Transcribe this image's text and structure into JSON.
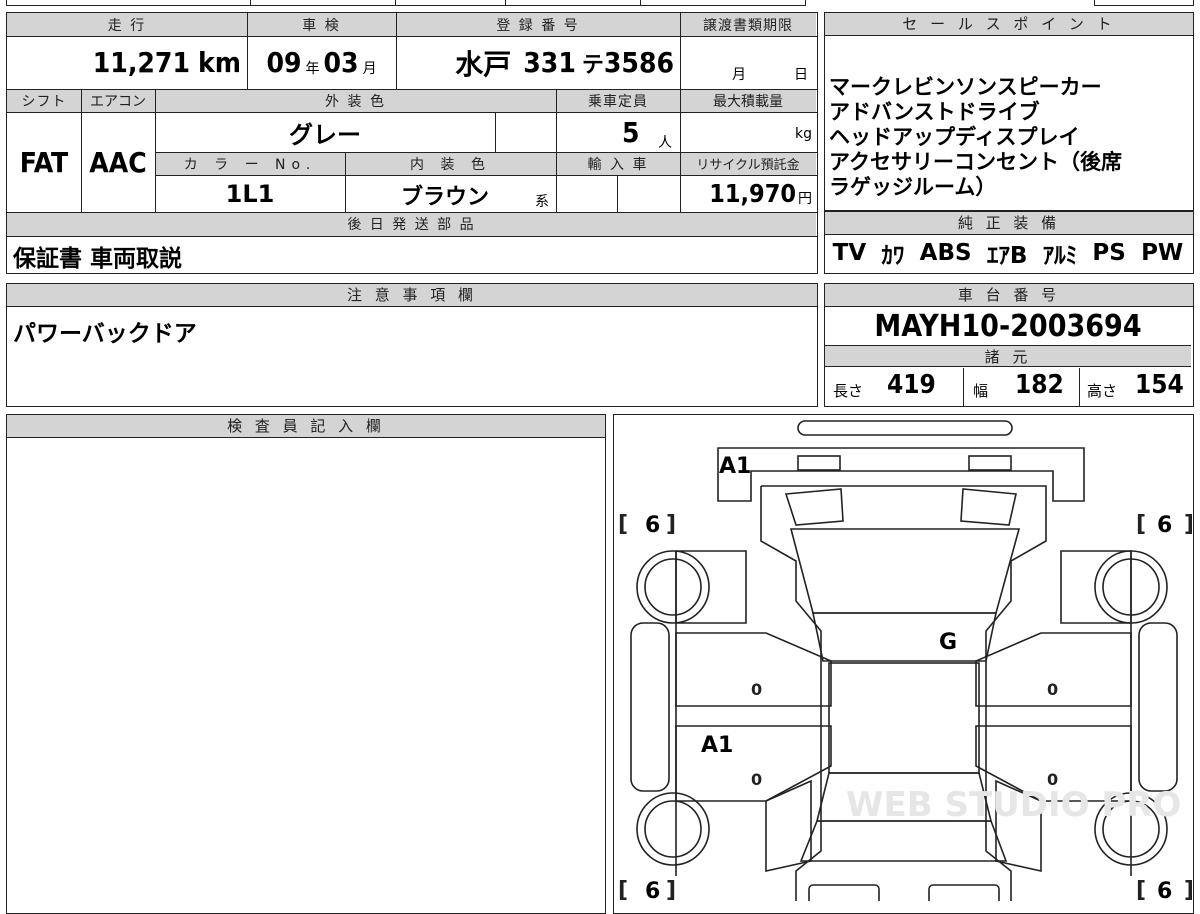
{
  "mileage": {
    "header": "走 行",
    "value": "11,271",
    "unit": "km"
  },
  "inspection": {
    "header": "車 検",
    "year": "09",
    "year_unit": "年",
    "month": "03",
    "month_unit": "月"
  },
  "registration": {
    "header": "登 録 番 号",
    "region": "水戸",
    "class": "331",
    "kana": "テ",
    "number": "3586"
  },
  "transfer_deadline": {
    "header": "譲渡書類期限",
    "month_unit": "月",
    "day_unit": "日"
  },
  "shift": {
    "header": "シフト",
    "value": "FAT"
  },
  "aircon": {
    "header": "エアコン",
    "value": "AAC"
  },
  "exterior_color": {
    "header": "外 装 色",
    "value": "グレー"
  },
  "capacity": {
    "header": "乗車定員",
    "value": "5",
    "unit": "人"
  },
  "max_load": {
    "header": "最大積載量",
    "unit": "kg"
  },
  "color_no": {
    "header": "カ ラ ー No.",
    "value": "1L1"
  },
  "interior_color": {
    "header": "内 装 色",
    "value": "ブラウン",
    "suffix": "系"
  },
  "import": {
    "header": "輸 入 車"
  },
  "recycle": {
    "header": "リサイクル預託金",
    "value": "11,970",
    "unit": "円"
  },
  "sales_points": {
    "header": "セ ー ル ス ポ イ ン ト",
    "items": [
      "マークレビンソンスピーカー",
      "アドバンストドライブ",
      "ヘッドアップディスプレイ",
      "アクセサリーコンセント（後席",
      "ラゲッジルーム）"
    ]
  },
  "later_parts": {
    "header": "後 日 発 送 部 品",
    "value": "保証書 車両取説"
  },
  "standard_equipment": {
    "header": "純 正 装 備",
    "items": [
      "TV",
      "ｶﾜ",
      "ABS",
      "ｴｱB",
      "ｱﾙﾐ",
      "PS",
      "PW"
    ]
  },
  "notes": {
    "header": "注 意 事 項 欄",
    "value": "パワーバックドア"
  },
  "chassis": {
    "header": "車 台 番 号",
    "value": "MAYH10-2003694"
  },
  "specs": {
    "header": "諸 元",
    "length_label": "長さ",
    "length": "419",
    "width_label": "幅",
    "width": "182",
    "height_label": "高さ",
    "height": "154"
  },
  "inspector": {
    "header": "検 査 員 記 入 欄"
  },
  "diagram": {
    "marks": {
      "front_bumper": "A1",
      "roof": "G",
      "left_door": "A1",
      "door_zero": "0"
    },
    "tires": {
      "front_left": "6",
      "front_right": "6",
      "rear_left": "6",
      "rear_right": "6"
    },
    "watermark": "WEB STUDIO PRO"
  }
}
